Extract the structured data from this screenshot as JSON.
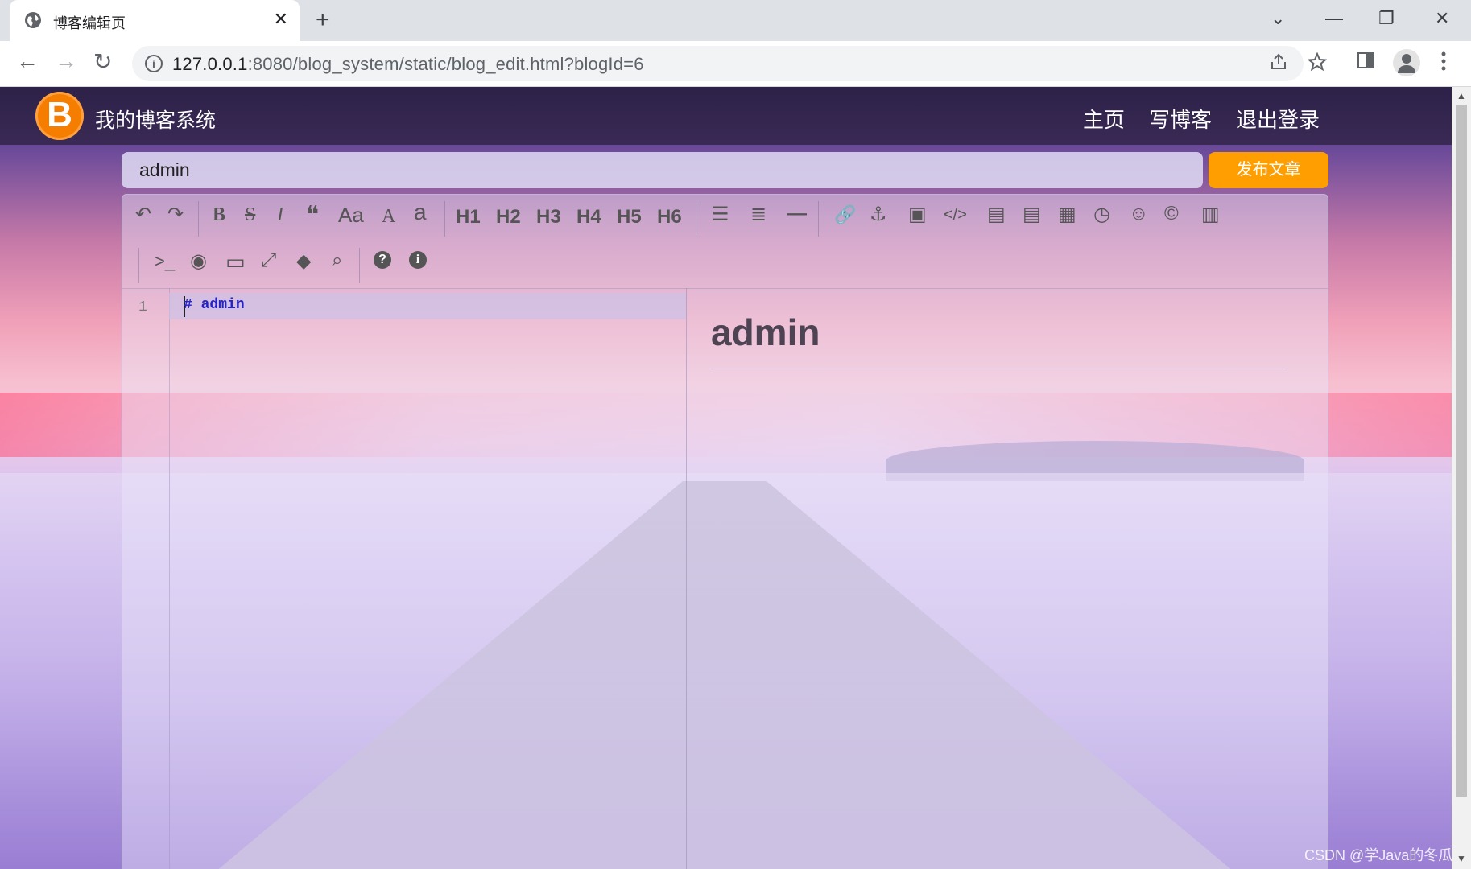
{
  "browser": {
    "tab_title": "博客编辑页",
    "tab_close": "✕",
    "new_tab": "+",
    "url_host": "127.0.0.1",
    "url_rest": ":8080/blog_system/static/blog_edit.html?blogId=6",
    "nav_back": "←",
    "nav_forward": "→",
    "nav_reload": "↻",
    "win_dropdown": "⌄",
    "win_minimize": "—",
    "win_restore": "❐",
    "win_close": "✕"
  },
  "nav": {
    "logo_letter": "B",
    "site_name": "我的博客系统",
    "links": [
      "主页",
      "写博客",
      "退出登录"
    ]
  },
  "editor": {
    "title_value": "admin",
    "publish_label": "发布文章",
    "toolbar_row1": [
      "↶",
      "↷",
      "B",
      "S",
      "I",
      "❝",
      "Aa",
      "A",
      "a",
      "H1",
      "H2",
      "H3",
      "H4",
      "H5",
      "H6",
      "☰",
      "≣",
      "—",
      "🔗",
      "⚓",
      "▣",
      "</>",
      "▤",
      "▤",
      "▦",
      "◷",
      "☺",
      "©",
      "▥"
    ],
    "toolbar_row2": [
      ">_",
      "◉",
      "▭",
      "⤢",
      "◆",
      "⌕",
      "?",
      "i"
    ],
    "line_number": "1",
    "code_hash": "#",
    "code_text": "admin",
    "preview_heading": "admin"
  },
  "watermark": "CSDN @学Java的冬瓜"
}
